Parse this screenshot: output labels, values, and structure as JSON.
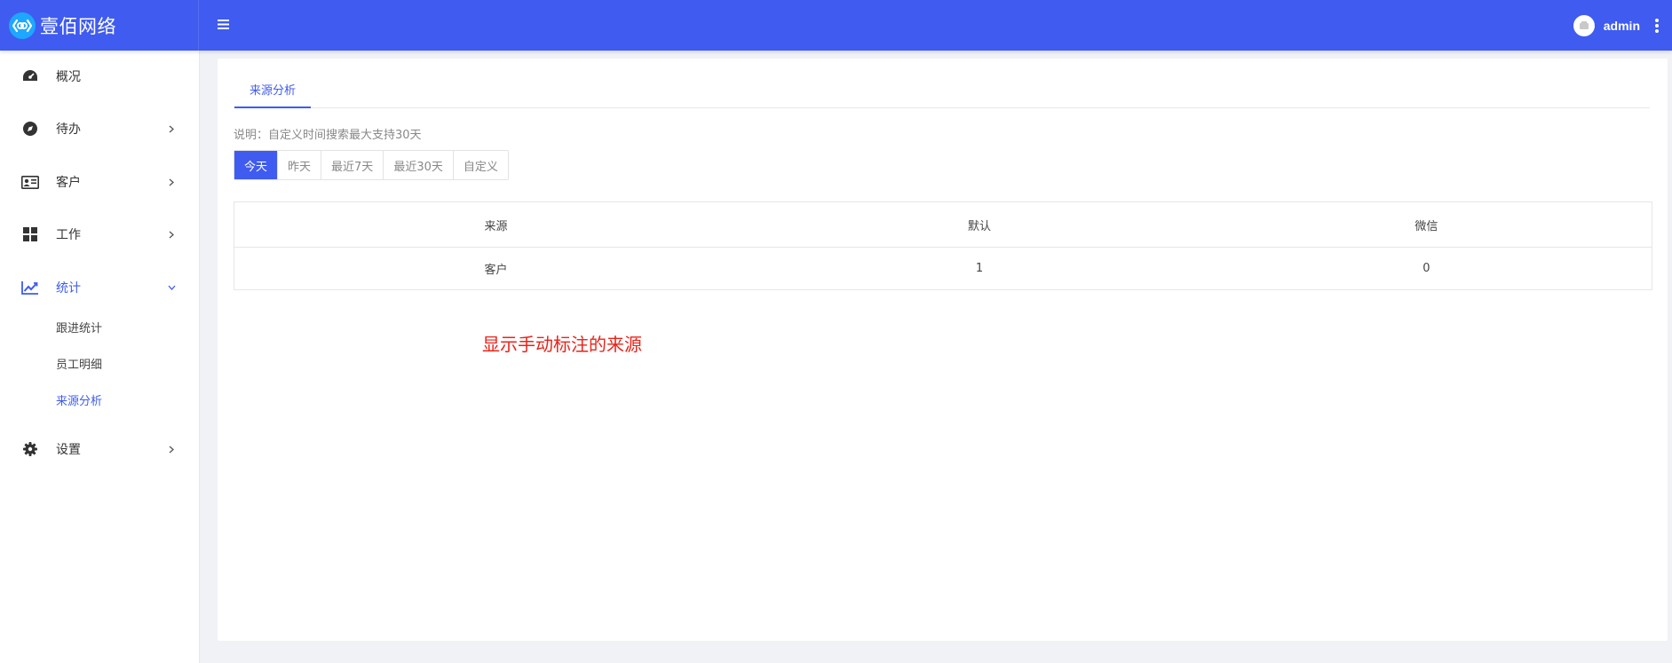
{
  "brand": {
    "name": "壹佰网络",
    "colors": {
      "primary": "#3f5bf0",
      "logo": "#1ea7ff",
      "annotation": "#e8231a"
    }
  },
  "header": {
    "menu_icon": "hamburger-icon",
    "user_name": "admin",
    "more_icon": "more-vertical-icon"
  },
  "sidebar": {
    "items": [
      {
        "label": "概况",
        "icon": "dashboard-icon"
      },
      {
        "label": "待办",
        "icon": "compass-icon"
      },
      {
        "label": "客户",
        "icon": "id-card-icon"
      },
      {
        "label": "工作",
        "icon": "grid-icon"
      },
      {
        "label": "统计",
        "icon": "chart-line-icon",
        "expanded": true
      },
      {
        "label": "设置",
        "icon": "gear-icon"
      }
    ],
    "sub_items": [
      {
        "label": "跟进统计"
      },
      {
        "label": "员工明细"
      },
      {
        "label": "来源分析",
        "active": true
      }
    ]
  },
  "main": {
    "tab": "来源分析",
    "note": "说明：自定义时间搜索最大支持30天",
    "date_buttons": [
      "今天",
      "昨天",
      "最近7天",
      "最近30天",
      "自定义"
    ],
    "active_date_button": "今天",
    "table": {
      "headers": [
        "来源",
        "默认",
        "微信"
      ],
      "rows": [
        [
          "客户",
          "1",
          "0"
        ]
      ]
    },
    "annotation": "显示手动标注的来源"
  }
}
